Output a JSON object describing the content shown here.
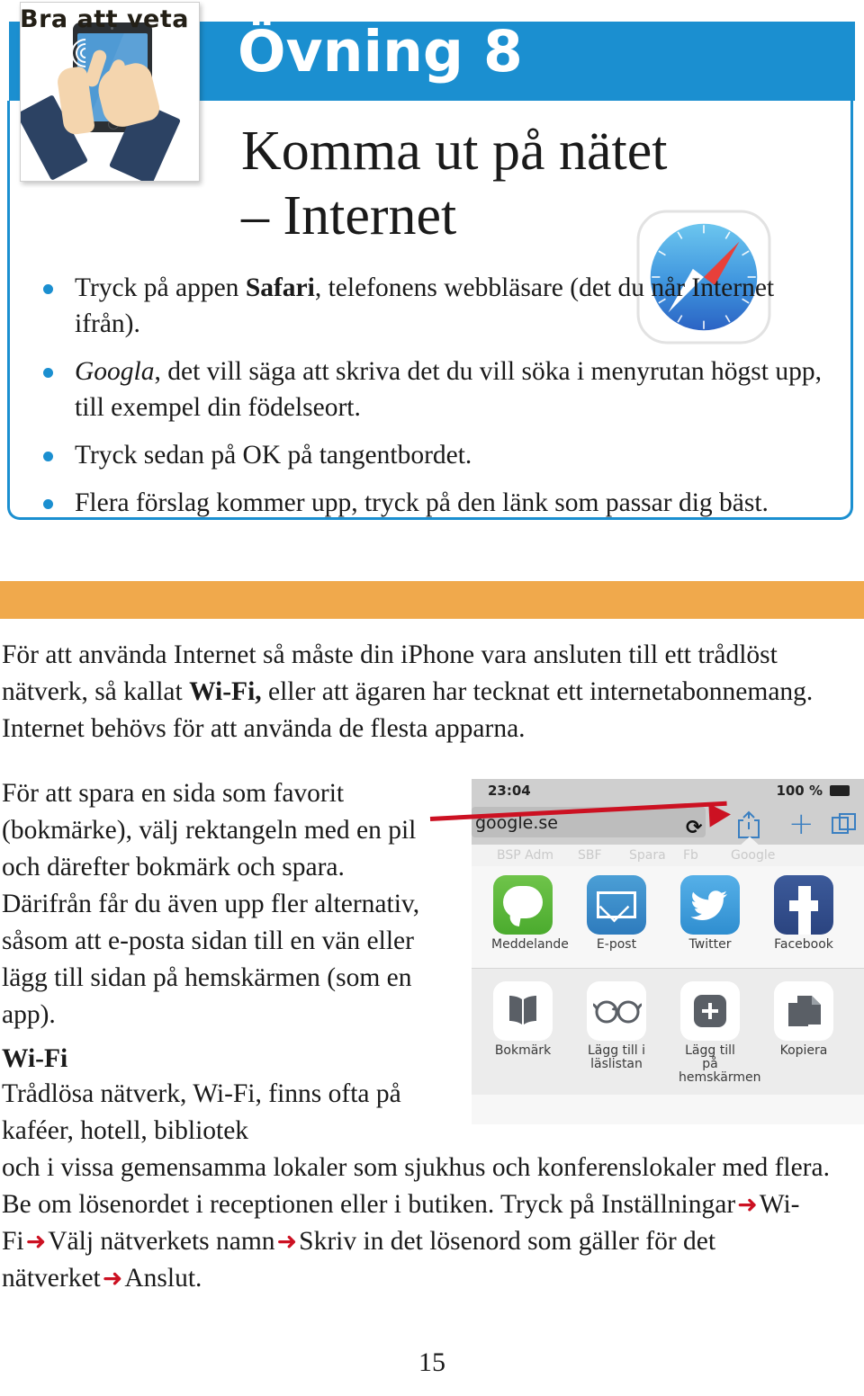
{
  "header": {
    "exercise_label": "Övning 8",
    "title_line1": "Komma ut på nätet",
    "title_line2": "– Internet",
    "illustration_name": "hand-tapping-tablet",
    "app_icon_name": "safari-compass-icon"
  },
  "intro_bullets": [
    {
      "pre": "Tryck på appen ",
      "bold": "Safari",
      "post": ", telefonens webbläsare (det du når Internet ifrån)."
    },
    {
      "italic": "Googla",
      "post": ", det vill säga att skriva det du vill söka i menyrutan högst upp, till exempel din födelseort."
    },
    {
      "plain": "Tryck sedan på OK på tangentbordet."
    },
    {
      "plain": "Flera förslag kommer upp, tryck på den länk som passar dig bäst."
    }
  ],
  "good_to_know": {
    "banner_label": "Bra att veta",
    "paragraph_pre": "För att använda Internet så måste din iPhone vara ansluten till ett trådlöst nätverk, så kallat ",
    "paragraph_bold": "Wi-Fi,",
    "paragraph_post": " eller att ägaren har tecknat ett internetabonnemang. Internet behövs för att använda de flesta apparna."
  },
  "favorite_paragraph": "För att spara en sida som favorit (bokmärke), välj rektangeln med en pil och därefter bokmärk och spara. Därifrån får du även upp fler alternativ, såsom att e-posta sidan till en vän eller lägg till sidan på hemskärmen (som en app).",
  "phone_screenshot": {
    "status_time": "23:04",
    "battery_percent": "100 %",
    "url": "google.se",
    "reload_icon_name": "reload-icon",
    "share_icon_name": "share-icon",
    "plus_icon_name": "plus-icon",
    "tabs_icon_name": "tabs-icon",
    "bookmark_bar": [
      "BSP Adm",
      "SBF",
      "Spara",
      "Fb",
      "Google"
    ],
    "share_apps": [
      {
        "label": "Meddelande",
        "icon": "messages-icon"
      },
      {
        "label": "E-post",
        "icon": "mail-icon"
      },
      {
        "label": "Twitter",
        "icon": "twitter-icon"
      },
      {
        "label": "Facebook",
        "icon": "facebook-icon"
      }
    ],
    "share_actions": [
      {
        "label": "Bokmärk",
        "icon": "book-icon"
      },
      {
        "label": "Lägg till i läslistan",
        "icon": "glasses-icon"
      },
      {
        "label": "Lägg till på hemskärmen",
        "icon": "plus-square-icon"
      },
      {
        "label": "Kopiera",
        "icon": "copy-icon"
      }
    ],
    "annotation_arrow": "red-arrow-to-share-icon"
  },
  "wifi_section": {
    "heading": "Wi-Fi",
    "paragraph_a": "Trådlösa nätverk, Wi-Fi, finns ofta på kaféer, hotell, bibliotek",
    "paragraph_b_intro": "och i vissa gemensamma lokaler som sjukhus och konferenslokaler med flera. Be om lösenordet i receptionen eller i butiken. Tryck på ",
    "steps": [
      "Inställningar",
      "Wi-Fi",
      "Välj nätverkets namn",
      "Skriv in det lösenord som gäller för det nätverket",
      "Anslut."
    ],
    "arrow_glyph": "➜"
  },
  "footer": {
    "page_number": "15"
  },
  "colors": {
    "banner_blue": "#1b8fd0",
    "banner_orange": "#f0a94c",
    "arrow_red": "#cc1122",
    "bullet_blue": "#1b8fd0"
  }
}
